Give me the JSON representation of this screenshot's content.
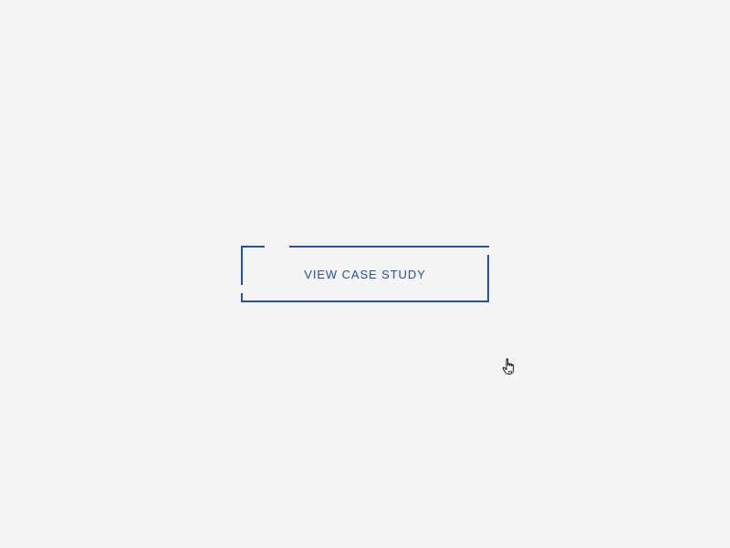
{
  "cta": {
    "label": "VIEW CASE STUDY"
  },
  "colors": {
    "background": "#f5f5f5",
    "accent": "#1f4fb8"
  },
  "icons": {
    "cursor": "hand-pointer-icon"
  }
}
